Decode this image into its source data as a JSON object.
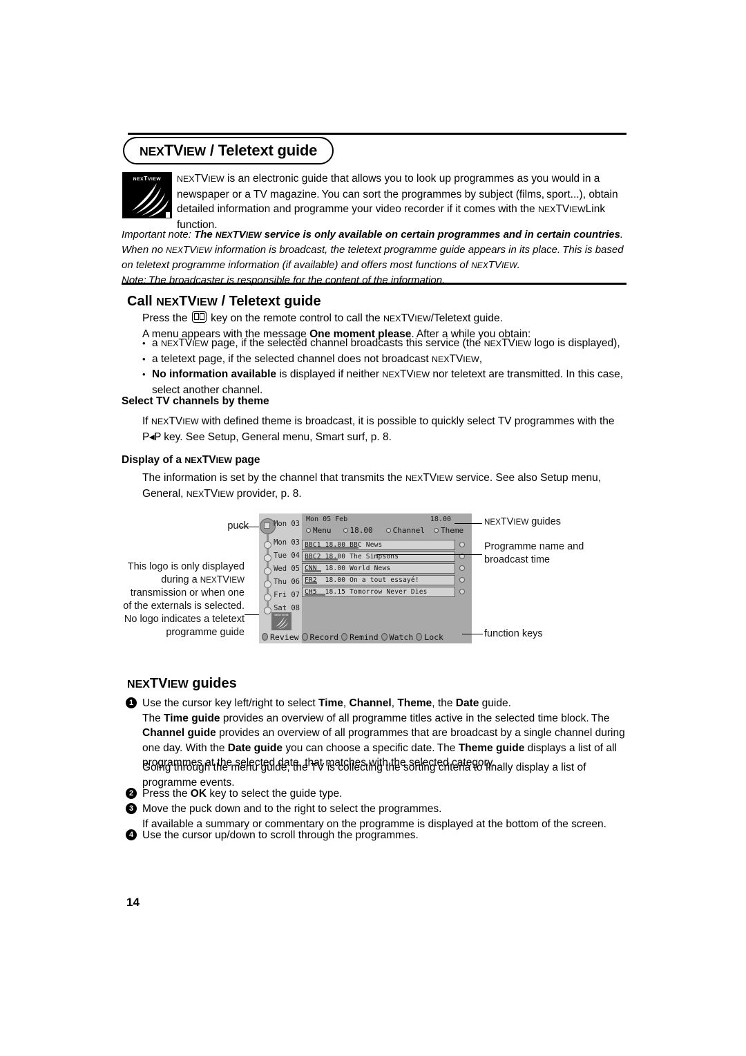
{
  "page": {
    "number": "14"
  },
  "title_pill": {
    "text": "NEXTVIEW / Teletext guide"
  },
  "logo": {
    "wordmark": "NEXTVIEW",
    "alt": "nextview-logo"
  },
  "intro": {
    "paragraph": "NEXTVIEW is an electronic guide that allows you to look up programmes as you would in a newspaper or a TV magazine. You can sort the programmes by subject (films, sport...), obtain detailed information and programme your video recorder if it comes with the NEXTVIEWLink function."
  },
  "note": {
    "label": "Important note:",
    "bold_part": "The NEXTVIEW service is only available on certain programmes and in certain countries",
    "rest": ". When no NEXTVIEW information is broadcast, the teletext programme guide appears in its place. This is based on teletext programme information (if available) and offers most functions of NEXTVIEW.",
    "second_note": "Note: The broadcaster is responsible for the content of the information."
  },
  "call_section": {
    "heading": "Call NEXTVIEW / Teletext guide",
    "press_line_a": "Press the",
    "press_line_b": "key on the remote control to call the NEXTVIEW/Teletext guide.",
    "menu_line_a": "A menu appears with the message",
    "menu_line_bold": "One moment please",
    "menu_line_b": ". After a while you obtain:",
    "bullets": [
      "a NEXTVIEW page, if the selected channel broadcasts this service (the NEXTVIEW logo is displayed),",
      "a teletext page, if the selected channel does not broadcast NEXTVIEW,",
      "No information available is displayed if neither NEXTVIEW nor teletext are transmitted. In this case, select another channel."
    ],
    "bullet3_bold": "No information available",
    "bullet3_rest": "is displayed if neither NEXTVIEW nor teletext are transmitted. In this case, select another channel."
  },
  "theme_section": {
    "heading": "Select TV channels by theme",
    "body_a": "If NEXTVIEW with defined theme is broadcast, it is possible to quickly select TV programmes with the",
    "key_glyph": "P◂P",
    "body_b": "key. See Setup, General menu, Smart surf, p. 8."
  },
  "display_section": {
    "heading": "Display of a NEXTVIEW page",
    "body": "The information is set by the channel that transmits the NEXTVIEW service. See also Setup menu, General, NEXTVIEW provider, p. 8."
  },
  "diagram": {
    "callouts": {
      "puck": "puck",
      "logo_note": "This logo is only displayed during a NEXTVIEW transmission or when one of the externals is selected. No logo indicates a teletext programme guide",
      "guides": "NEXTVIEW guides",
      "programme": "Programme name and broadcast time",
      "function_keys": "function keys"
    },
    "screen": {
      "date": "Mon 05 Feb",
      "clock": "18.00",
      "tabs": [
        {
          "label": "Menu"
        },
        {
          "label": "18.00"
        },
        {
          "label": "Channel"
        },
        {
          "label": "Theme"
        }
      ],
      "days": [
        "Mon 03",
        "Mon 03",
        "Tue 04",
        "Wed 05",
        "Thu 06",
        "Fri 07",
        "Sat 08"
      ],
      "programmes": [
        {
          "channel": "BBC1",
          "time": "18.00",
          "title": "BBC News",
          "progress": 36
        },
        {
          "channel": "BBC2",
          "time": "18.00",
          "title": "The Simpsons",
          "progress": 22
        },
        {
          "channel": "CNN",
          "time": "18.00",
          "title": "World News",
          "progress": 11
        },
        {
          "channel": "FR2",
          "time": "18.00",
          "title": "On a tout essayé!",
          "progress": 8
        },
        {
          "channel": "CH5",
          "time": "18.15",
          "title": "Tomorrow Never Dies",
          "progress": 14
        }
      ],
      "function_keys": [
        "Review",
        "Record",
        "Remind",
        "Watch",
        "Lock"
      ],
      "logo_wordmark": "NEXTVIEW"
    }
  },
  "guides_section": {
    "heading": "NEXTVIEW guides",
    "step1_a": "Use the cursor key left/right to select",
    "step1_time": "Time",
    "step1_channel": "Channel",
    "step1_theme": "Theme",
    "step1_the": ", the",
    "step1_date": "Date",
    "step1_guide": "guide.",
    "step1_p2_a": "The",
    "step1_p2_timeguide": "Time guide",
    "step1_p2_b": "provides an overview of all programme titles active in the selected time block. The",
    "step1_p2_channelguide": "Channel guide",
    "step1_p2_c": "provides an overview of all programmes that are broadcast by a single channel during one day. With the",
    "step1_p2_dateguide": "Date guide",
    "step1_p2_d": "you can choose a specific date. The",
    "step1_p2_themeguide": "Theme guide",
    "step1_p2_e": "displays a list of all programmes at the selected date, that matches with the selected category.",
    "step1_p3": "Going through the menu guide, the TV is collecting the sorting criteria to finally display a list of programme events.",
    "step2_a": "Press the",
    "step2_ok": "OK",
    "step2_b": "key to select the guide type.",
    "step3": "Move the puck down and to the right to select the programmes.",
    "step3_note": "If available a summary or commentary on the programme is displayed at the bottom of the screen.",
    "step4": "Use the cursor up/down to scroll through the programmes.",
    "markers": [
      "❶",
      "❷",
      "❸",
      "❹"
    ]
  },
  "colors": {
    "screen_bg": "#a9a9a9",
    "screen_panel": "#cdcdcd",
    "row_bg": "#d3d3d3",
    "row_border": "#5e5e5e",
    "bar": "#6f6f6f",
    "text": "#000000"
  }
}
